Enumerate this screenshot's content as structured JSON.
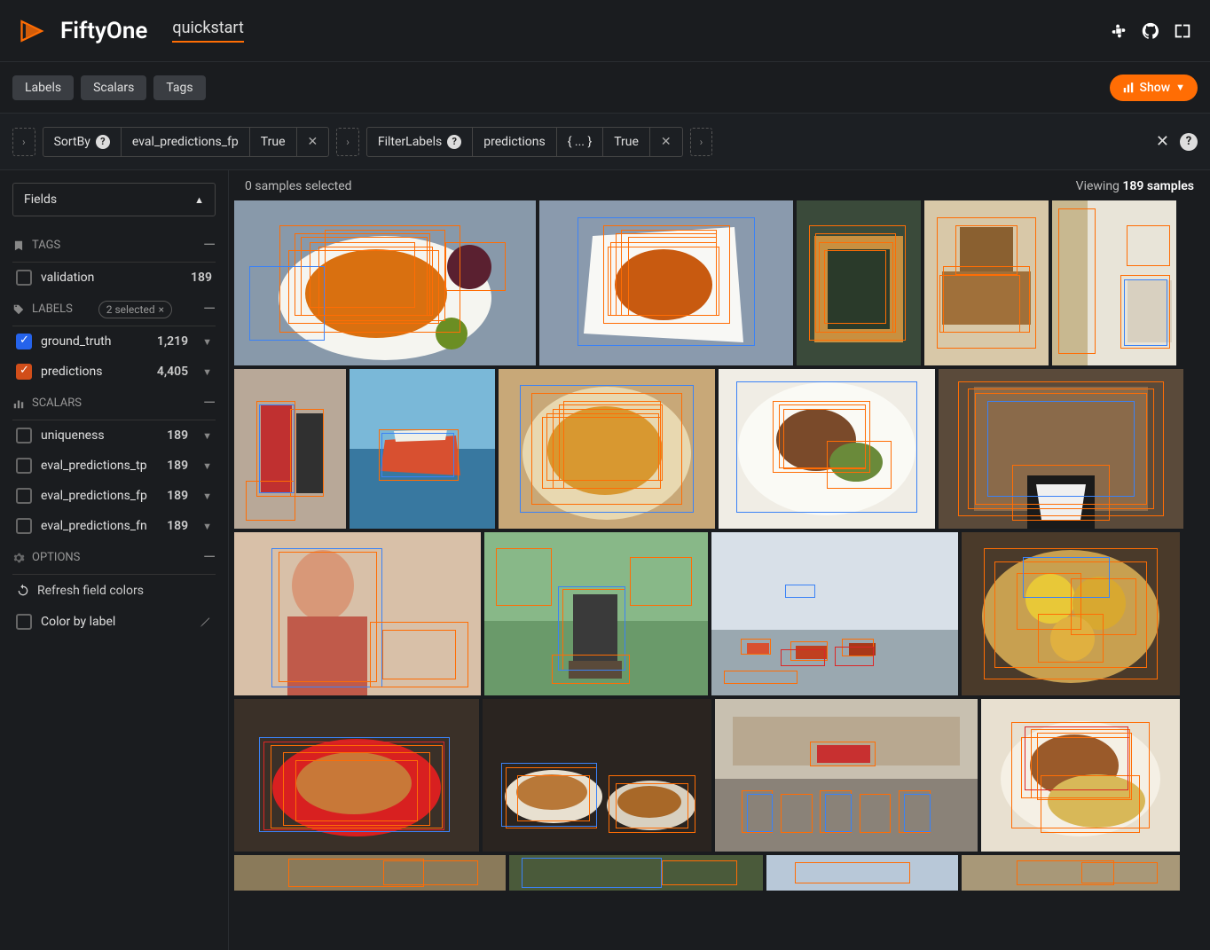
{
  "header": {
    "app_name": "FiftyOne",
    "dataset": "quickstart"
  },
  "toolbar": {
    "labels_chip": "Labels",
    "scalars_chip": "Scalars",
    "tags_chip": "Tags",
    "show_button": "Show"
  },
  "stages": [
    {
      "name": "SortBy",
      "param": "eval_predictions_fp",
      "value": "True"
    },
    {
      "name": "FilterLabels",
      "param": "predictions",
      "extra": "{ ... }",
      "value": "True"
    }
  ],
  "sidebar": {
    "fields_label": "Fields",
    "tags_header": "TAGS",
    "tags": [
      {
        "label": "validation",
        "count": "189"
      }
    ],
    "labels_header": "LABELS",
    "labels_selected_pill": "2 selected",
    "labels": [
      {
        "label": "ground_truth",
        "count": "1,219",
        "checked": "blue"
      },
      {
        "label": "predictions",
        "count": "4,405",
        "checked": "orange"
      }
    ],
    "scalars_header": "SCALARS",
    "scalars": [
      {
        "label": "uniqueness",
        "count": "189"
      },
      {
        "label": "eval_predictions_tp",
        "count": "189"
      },
      {
        "label": "eval_predictions_fp",
        "count": "189"
      },
      {
        "label": "eval_predictions_fn",
        "count": "189"
      }
    ],
    "options_header": "OPTIONS",
    "refresh_label": "Refresh field colors",
    "color_by_label": "Color by label"
  },
  "content": {
    "selected_text": "0 samples selected",
    "viewing_prefix": "Viewing ",
    "viewing_count": "189",
    "viewing_suffix": " samples"
  },
  "colors": {
    "accent": "#ff6d04",
    "bg": "#1a1c1f"
  }
}
